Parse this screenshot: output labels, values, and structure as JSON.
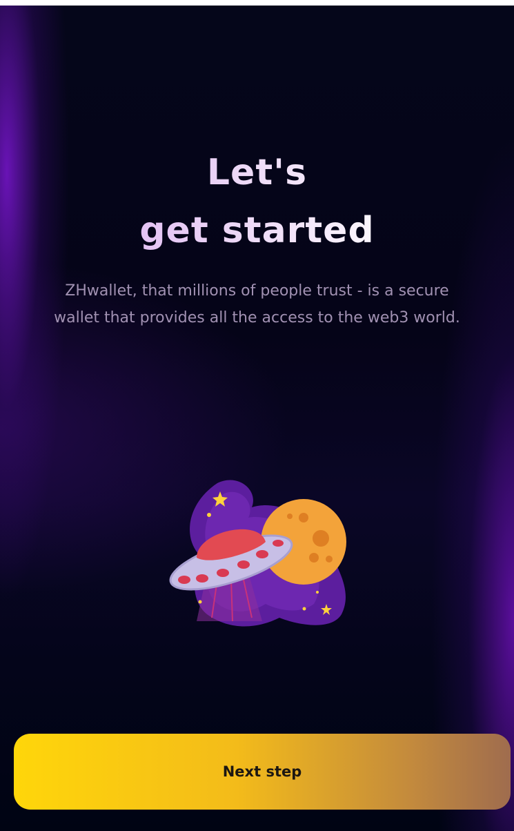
{
  "onboarding": {
    "title_line1": "Let's",
    "title_line2": "get started",
    "description": "ZHwallet, that millions of people trust - is a secure wallet that provides all the access to the web3 world.",
    "illustration_icon": "ufo-planet-illustration"
  },
  "actions": {
    "next_label": "Next step"
  },
  "colors": {
    "background": "#000413",
    "accent_purple": "#6e14be",
    "button_start": "#ffd60a",
    "button_end": "#9f6c4e",
    "title": "#ecd6f6",
    "description": "#a191b2"
  }
}
